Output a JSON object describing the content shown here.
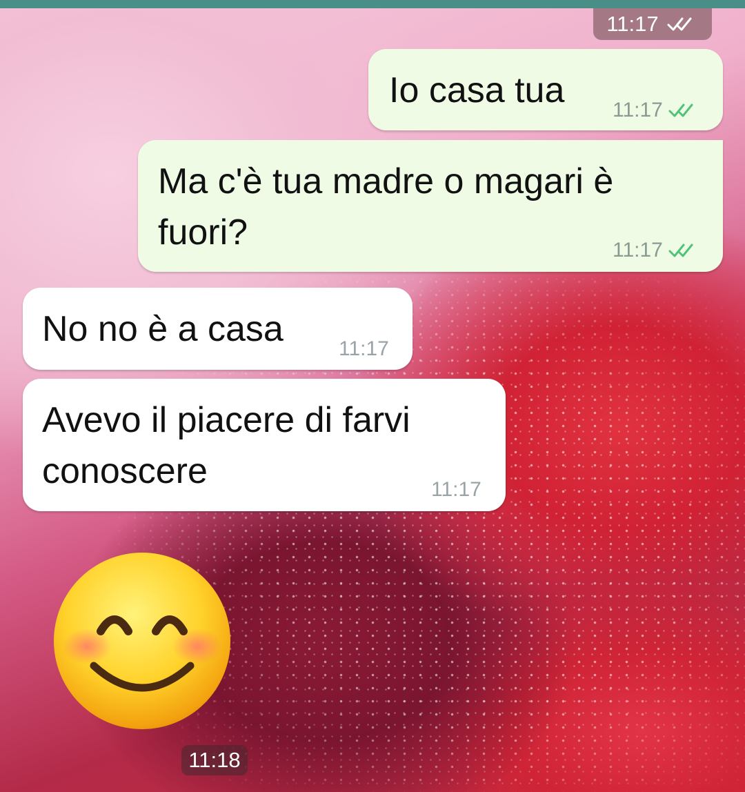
{
  "header": {
    "status_time": "11:17",
    "status_tick": "double-check-icon"
  },
  "messages": [
    {
      "direction": "outgoing",
      "text": "Io casa tua",
      "time": "11:17",
      "status_icon": "double-check-icon"
    },
    {
      "direction": "outgoing",
      "text_lines": [
        "Ma c'è tua madre o magari è",
        "fuori?"
      ],
      "time": "11:17",
      "status_icon": "double-check-icon"
    },
    {
      "direction": "incoming",
      "text": "No no è a casa",
      "time": "11:17"
    },
    {
      "direction": "incoming",
      "text_lines": [
        "Avevo il piacere di farvi",
        "conoscere"
      ],
      "time": "11:17"
    }
  ],
  "sticker": {
    "icon": "smiling-face-with-smiling-eyes-icon",
    "time": "11:18"
  },
  "colors": {
    "outgoing_bubble": "#effbe5",
    "incoming_bubble": "#ffffff",
    "read_tick": "#4fc37a",
    "top_strip": "#4a8f87"
  }
}
